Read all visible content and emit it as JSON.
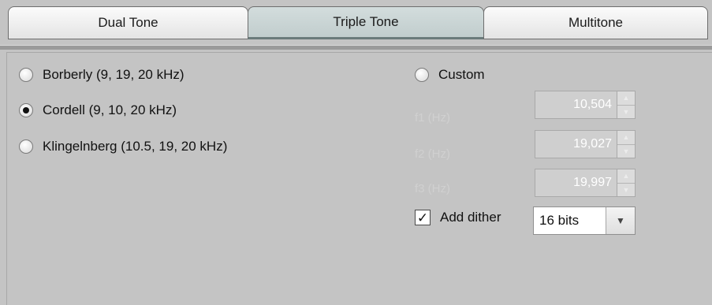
{
  "tabs": [
    {
      "label": "Dual Tone",
      "selected": false
    },
    {
      "label": "Triple Tone",
      "selected": true
    },
    {
      "label": "Multitone",
      "selected": false
    }
  ],
  "presets": [
    {
      "label": "Borberly (9, 19, 20 kHz)",
      "selected": false
    },
    {
      "label": "Cordell (9, 10, 20 kHz)",
      "selected": true
    },
    {
      "label": "Klingelnberg (10.5, 19, 20 kHz)",
      "selected": false
    }
  ],
  "custom": {
    "label": "Custom",
    "selected": false,
    "fields": [
      {
        "label": "f1 (Hz)",
        "value": "10,504"
      },
      {
        "label": "f2 (Hz)",
        "value": "19,027"
      },
      {
        "label": "f3 (Hz)",
        "value": "19,997"
      }
    ]
  },
  "dither": {
    "label": "Add dither",
    "checked": true,
    "bits": "16 bits"
  },
  "icons": {
    "check": "✓",
    "spin_up": "▲",
    "spin_down": "▼",
    "dropdown": "▼"
  }
}
